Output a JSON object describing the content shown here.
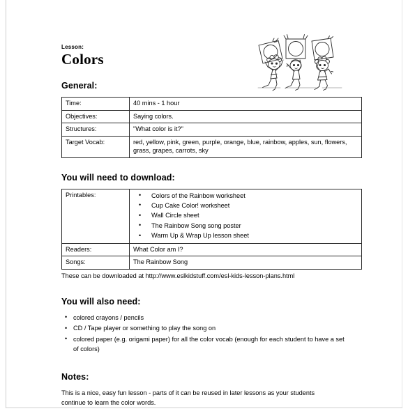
{
  "header": {
    "lesson_label": "Lesson:",
    "title": "Colors",
    "illustration_alt": "three-children-holding-color-cards-illustration"
  },
  "sections": {
    "general": {
      "heading": "General:",
      "rows": [
        {
          "label": "Time:",
          "value": "40 mins - 1 hour"
        },
        {
          "label": "Objectives:",
          "value": "Saying colors."
        },
        {
          "label": "Structures:",
          "value": "\"What color is it?\""
        },
        {
          "label": "Target Vocab:",
          "value": "red, yellow, pink, green, purple, orange, blue, rainbow, apples, sun, flowers, grass, grapes, carrots, sky"
        }
      ]
    },
    "download": {
      "heading": "You will need to download:",
      "printables_label": "Printables:",
      "printables": [
        "Colors of the Rainbow worksheet",
        "Cup Cake Color! worksheet",
        "Wall Circle sheet",
        "The Rainbow Song song poster",
        "Warm Up & Wrap Up lesson sheet"
      ],
      "readers_label": "Readers:",
      "readers_value": "What Color am I?",
      "songs_label": "Songs:",
      "songs_value": "The Rainbow Song",
      "download_note": "These can be downloaded at http://www.eslkidstuff.com/esl-kids-lesson-plans.html"
    },
    "also_need": {
      "heading": "You will also need:",
      "items": [
        "colored crayons / pencils",
        "CD / Tape player or something to play the song on",
        "colored paper (e.g. origami paper) for all the color vocab (enough for each student to have a set of colors)"
      ]
    },
    "notes": {
      "heading": "Notes:",
      "body": "This is a nice, easy fun lesson - parts of it can be reused in later lessons as your students continue to learn the color words."
    }
  },
  "colors": {
    "page_background": "#ffffff",
    "text": "#000000",
    "table_border": "#2a2a2a",
    "frame_line": "#cfcfcf"
  }
}
